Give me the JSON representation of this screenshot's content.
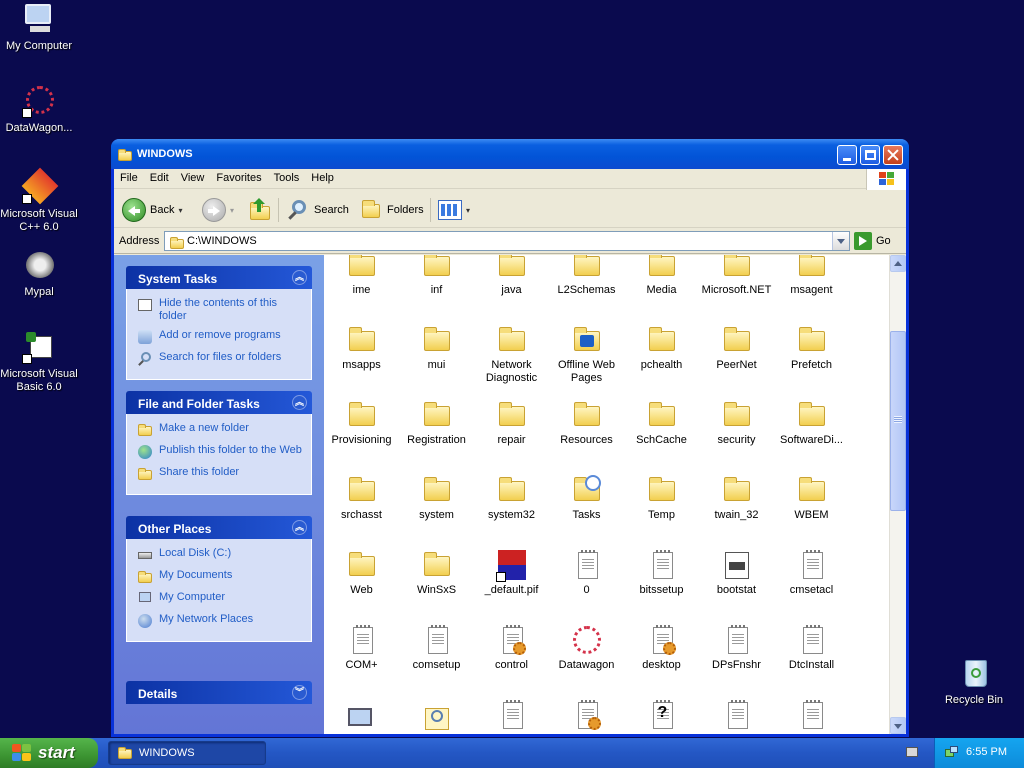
{
  "desktop": {
    "icons": [
      {
        "label": "My Computer"
      },
      {
        "label": "DataWagon..."
      },
      {
        "label": "Microsoft Visual C++ 6.0"
      },
      {
        "label": "Mypal"
      },
      {
        "label": "Microsoft Visual Basic 6.0"
      },
      {
        "label": "Recycle Bin"
      }
    ]
  },
  "window": {
    "title": "WINDOWS",
    "menu": [
      "File",
      "Edit",
      "View",
      "Favorites",
      "Tools",
      "Help"
    ],
    "toolbar": {
      "back": "Back",
      "search": "Search",
      "folders": "Folders"
    },
    "address": {
      "label": "Address",
      "value": "C:\\WINDOWS",
      "go": "Go"
    }
  },
  "leftpane": {
    "system_tasks": {
      "title": "System Tasks",
      "items": [
        "Hide the contents of this folder",
        "Add or remove programs",
        "Search for files or folders"
      ]
    },
    "file_tasks": {
      "title": "File and Folder Tasks",
      "items": [
        "Make a new folder",
        "Publish this folder to the Web",
        "Share this folder"
      ]
    },
    "other_places": {
      "title": "Other Places",
      "items": [
        "Local Disk (C:)",
        "My Documents",
        "My Computer",
        "My Network Places"
      ]
    },
    "details": {
      "title": "Details"
    }
  },
  "files": [
    [
      "ime",
      "inf",
      "java",
      "L2Schemas",
      "Media",
      "Microsoft.NET",
      "msagent"
    ],
    [
      "msapps",
      "mui",
      "Network Diagnostic",
      "Offline Web Pages",
      "pchealth",
      "PeerNet",
      "Prefetch"
    ],
    [
      "Provisioning",
      "Registration",
      "repair",
      "Resources",
      "SchCache",
      "security",
      "SoftwareDi..."
    ],
    [
      "srchasst",
      "system",
      "system32",
      "Tasks",
      "Temp",
      "twain_32",
      "WBEM"
    ],
    [
      "Web",
      "WinSxS",
      "_default.pif",
      "0",
      "bitssetup",
      "bootstat",
      "cmsetacl"
    ],
    [
      "COM+",
      "comsetup",
      "control",
      "Datawagon",
      "desktop",
      "DPsFnshr",
      "DtcInstall"
    ],
    [
      "",
      "",
      "",
      "",
      "",
      "",
      ""
    ]
  ],
  "taskbar": {
    "start": "start",
    "task": "WINDOWS",
    "clock": "6:55 PM"
  }
}
